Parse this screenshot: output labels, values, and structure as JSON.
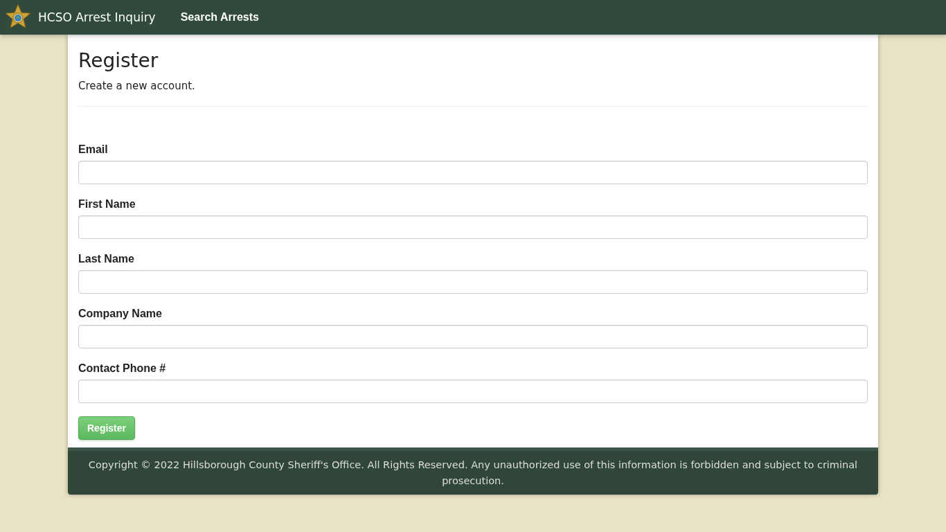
{
  "navbar": {
    "brand": "HCSO Arrest Inquiry",
    "links": [
      {
        "label": "Search Arrests"
      }
    ]
  },
  "page": {
    "title": "Register",
    "subtitle": "Create a new account."
  },
  "form": {
    "fields": [
      {
        "label": "Email"
      },
      {
        "label": "First Name"
      },
      {
        "label": "Last Name"
      },
      {
        "label": "Company Name"
      },
      {
        "label": "Contact Phone #"
      }
    ],
    "submit": "Register"
  },
  "footer": {
    "text": "Copyright © 2022 Hillsborough County Sheriff's Office. All Rights Reserved. Any unauthorized use of this information is forbidden and subject to criminal prosecution."
  }
}
